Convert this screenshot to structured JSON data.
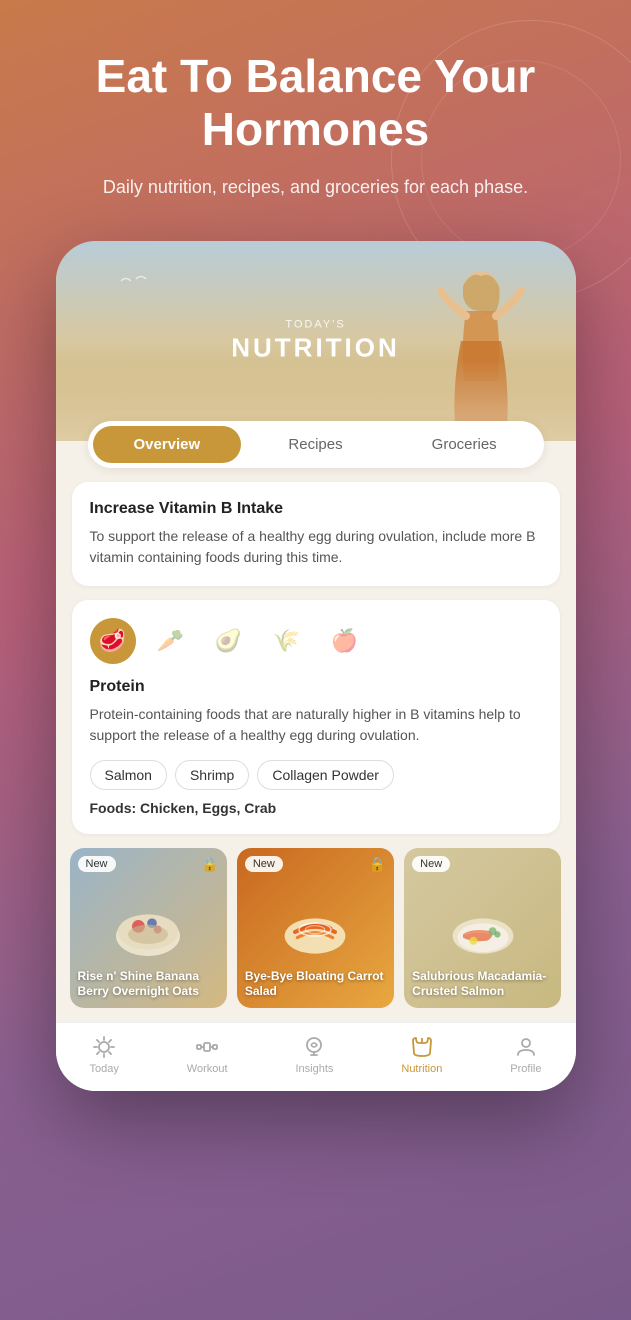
{
  "hero": {
    "title": "Eat To Balance Your Hormones",
    "subtitle": "Daily nutrition, recipes, and groceries for each phase."
  },
  "nutrition_screen": {
    "today_label": "TODAY'S",
    "nutrition_label": "NUTRITION"
  },
  "tabs": [
    {
      "label": "Overview",
      "active": true
    },
    {
      "label": "Recipes",
      "active": false
    },
    {
      "label": "Groceries",
      "active": false
    }
  ],
  "tip_card": {
    "title": "Increase Vitamin B Intake",
    "text": "To support the release of a healthy egg during ovulation, include more B vitamin containing foods during this time."
  },
  "food_section": {
    "icons": [
      {
        "emoji": "🥩",
        "active": true
      },
      {
        "emoji": "🥕",
        "active": false
      },
      {
        "emoji": "🥑",
        "active": false
      },
      {
        "emoji": "🌾",
        "active": false
      },
      {
        "emoji": "🍎",
        "active": false
      }
    ],
    "section_title": "Protein",
    "section_desc": "Protein-containing foods that are naturally higher in B vitamins help to support the release of a healthy egg during ovulation.",
    "tags": [
      "Salmon",
      "Shrimp",
      "Collagen Powder"
    ],
    "foods_label": "Foods:",
    "foods_list": "Chicken, Eggs, Crab"
  },
  "recipes": [
    {
      "badge": "New",
      "title": "Rise n' Shine Banana Berry Overnight Oats",
      "bg_color1": "#b0c4de",
      "bg_color2": "#c8a870"
    },
    {
      "badge": "New",
      "title": "Bye-Bye Bloating Carrot Salad",
      "bg_color1": "#d4823a",
      "bg_color2": "#e8b060"
    },
    {
      "badge": "New",
      "title": "Salubrious Macadamia-Crusted Salmon",
      "bg_color1": "#c8b890",
      "bg_color2": "#d4c8a0"
    }
  ],
  "bottom_nav": [
    {
      "label": "Today",
      "icon": "☀",
      "active": false
    },
    {
      "label": "Workout",
      "icon": "🏋",
      "active": false
    },
    {
      "label": "Insights",
      "icon": "💡",
      "active": false
    },
    {
      "label": "Nutrition",
      "icon": "🍴",
      "active": true
    },
    {
      "label": "Profile",
      "icon": "👤",
      "active": false
    }
  ]
}
